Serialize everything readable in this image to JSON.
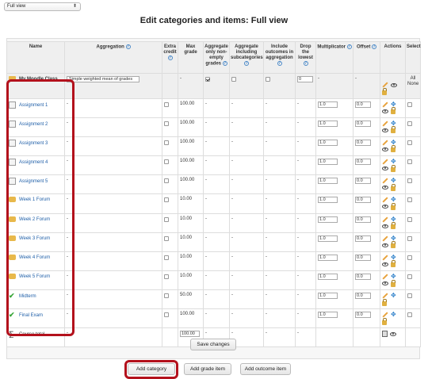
{
  "view_select": {
    "value": "Full view"
  },
  "page_title": "Edit categories and items: Full view",
  "table": {
    "headers": {
      "name": "Name",
      "aggregation": "Aggregation",
      "extra_credit": "Extra credit",
      "max_grade": "Max grade",
      "agg_nonempty": "Aggregate only non-empty grades",
      "agg_subcats": "Aggregate including subcategories",
      "include_outcomes": "Include outcomes in aggregation",
      "drop_lowest": "Drop the lowest",
      "multiplicator": "Multiplicator",
      "offset": "Offset",
      "actions": "Actions",
      "select": "Select"
    },
    "category": {
      "name": "My Moodle Class",
      "aggregation": "Simple weighted mean of grades",
      "max_grade": "-",
      "drop_lowest": "0",
      "multiplicator": "-",
      "offset": "-",
      "select_all": "All",
      "select_none": "None"
    },
    "items": [
      {
        "name": "Assignment 1",
        "type": "assignment",
        "dash": "-",
        "max": "100.00",
        "nonempty": "-",
        "subcats": "-",
        "outcomes": "-",
        "drop": "-",
        "mult": "1.0",
        "offset": "0.0",
        "actions": [
          "edit",
          "move",
          "hide",
          "lock"
        ]
      },
      {
        "name": "Assignment 2",
        "type": "assignment",
        "dash": "-",
        "max": "100.00",
        "nonempty": "-",
        "subcats": "-",
        "outcomes": "-",
        "drop": "-",
        "mult": "1.0",
        "offset": "0.0",
        "actions": [
          "edit",
          "move",
          "hide",
          "lock"
        ]
      },
      {
        "name": "Assignment 3",
        "type": "assignment",
        "dash": "-",
        "max": "100.00",
        "nonempty": "-",
        "subcats": "-",
        "outcomes": "-",
        "drop": "-",
        "mult": "1.0",
        "offset": "0.0",
        "actions": [
          "edit",
          "move",
          "hide",
          "lock"
        ]
      },
      {
        "name": "Assignment 4",
        "type": "assignment",
        "dash": "-",
        "max": "100.00",
        "nonempty": "-",
        "subcats": "-",
        "outcomes": "-",
        "drop": "-",
        "mult": "1.0",
        "offset": "0.0",
        "actions": [
          "edit",
          "move",
          "hide",
          "lock"
        ]
      },
      {
        "name": "Assignment 5",
        "type": "assignment",
        "dash": "-",
        "max": "100.00",
        "nonempty": "-",
        "subcats": "-",
        "outcomes": "-",
        "drop": "-",
        "mult": "1.0",
        "offset": "0.0",
        "actions": [
          "edit",
          "move",
          "hide",
          "lock"
        ]
      },
      {
        "name": "Week 1 Forum",
        "type": "forum",
        "dash": "-",
        "max": "10.00",
        "nonempty": "-",
        "subcats": "-",
        "outcomes": "-",
        "drop": "-",
        "mult": "1.0",
        "offset": "0.0",
        "actions": [
          "edit",
          "move",
          "hide",
          "lock"
        ]
      },
      {
        "name": "Week 2 Forum",
        "type": "forum",
        "dash": "-",
        "max": "10.00",
        "nonempty": "-",
        "subcats": "-",
        "outcomes": "-",
        "drop": "-",
        "mult": "1.0",
        "offset": "0.0",
        "actions": [
          "edit",
          "move",
          "hide",
          "lock"
        ]
      },
      {
        "name": "Week 3 Forum",
        "type": "forum",
        "dash": "-",
        "max": "10.00",
        "nonempty": "-",
        "subcats": "-",
        "outcomes": "-",
        "drop": "-",
        "mult": "1.0",
        "offset": "0.0",
        "actions": [
          "edit",
          "move",
          "hide",
          "lock"
        ]
      },
      {
        "name": "Week 4 Forum",
        "type": "forum",
        "dash": "-",
        "max": "10.00",
        "nonempty": "-",
        "subcats": "-",
        "outcomes": "-",
        "drop": "-",
        "mult": "1.0",
        "offset": "0.0",
        "actions": [
          "edit",
          "move",
          "hide",
          "lock"
        ]
      },
      {
        "name": "Week 5 Forum",
        "type": "forum",
        "dash": "-",
        "max": "10.00",
        "nonempty": "-",
        "subcats": "-",
        "outcomes": "-",
        "drop": "-",
        "mult": "1.0",
        "offset": "0.0",
        "actions": [
          "edit",
          "move",
          "hide",
          "lock"
        ]
      },
      {
        "name": "Midterm",
        "type": "manual",
        "dash": "-",
        "max": "50.00",
        "nonempty": "-",
        "subcats": "-",
        "outcomes": "-",
        "drop": "-",
        "mult": "1.0",
        "offset": "0.0",
        "actions": [
          "edit",
          "move",
          "lock"
        ]
      },
      {
        "name": "Final Exam",
        "type": "manual",
        "dash": "-",
        "max": "100.00",
        "nonempty": "-",
        "subcats": "-",
        "outcomes": "-",
        "drop": "-",
        "mult": "1.0",
        "offset": "0.0",
        "actions": [
          "edit",
          "move",
          "lock"
        ]
      }
    ],
    "total": {
      "name": "Course total",
      "dash": "-",
      "max": "100.00",
      "nonempty": "-",
      "subcats": "-",
      "outcomes": "-",
      "drop": "-"
    }
  },
  "buttons": {
    "save_changes": "Save changes",
    "add_category": "Add category",
    "add_grade_item": "Add grade item",
    "add_outcome_item": "Add outcome item"
  },
  "colors": {
    "highlight": "#b3111c",
    "link": "#1f5fa8",
    "folder": "#e8b84a",
    "check": "#3aa63a"
  }
}
